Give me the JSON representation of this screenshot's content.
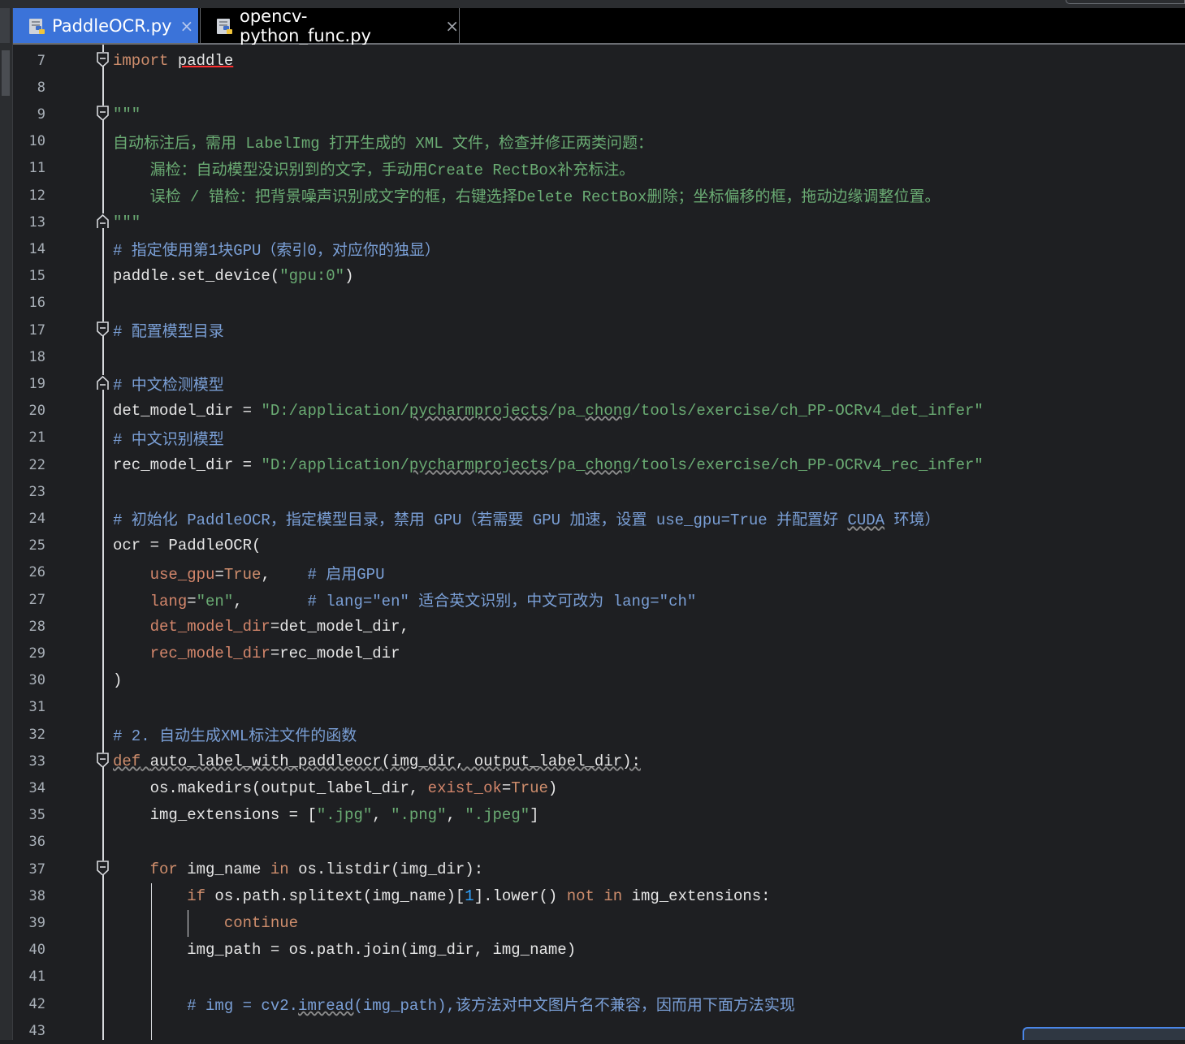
{
  "tabs": [
    {
      "label": "PaddleOCR.py",
      "active": true,
      "icon": "python-file-icon"
    },
    {
      "label": "opencv-python_func.py",
      "active": false,
      "icon": "python-file-icon"
    }
  ],
  "close_glyph": "×",
  "colors": {
    "background": "#1e1f22",
    "active_tab": "#3b73d9",
    "keyword": "#cf8e6d",
    "string": "#6aab73",
    "comment": "#7a9fd6",
    "param": "#d3866b",
    "number": "#2fa3ff",
    "text": "#e6e6e6"
  },
  "lines": [
    {
      "n": "7",
      "t": [
        "import",
        " ",
        "paddle"
      ]
    },
    {
      "n": "8",
      "t": [
        ""
      ]
    },
    {
      "n": "9",
      "t": [
        "\"\"\""
      ]
    },
    {
      "n": "10",
      "t": [
        "自动标注后，需用 LabelImg 打开生成的 XML 文件，检查并修正两类问题："
      ]
    },
    {
      "n": "11",
      "t": [
        "    漏检：自动模型没识别到的文字，手动用Create RectBox补充标注。"
      ]
    },
    {
      "n": "12",
      "t": [
        "    误检 / 错检：把背景噪声识别成文字的框，右键选择Delete RectBox删除；坐标偏移的框，拖动边缘调整位置。"
      ]
    },
    {
      "n": "13",
      "t": [
        "\"\"\""
      ]
    },
    {
      "n": "14",
      "t": [
        "# 指定使用第1块GPU（索引0，对应你的独显）"
      ]
    },
    {
      "n": "15",
      "t": [
        "paddle.set_device(",
        "\"gpu:0\"",
        ")"
      ]
    },
    {
      "n": "16",
      "t": [
        ""
      ]
    },
    {
      "n": "17",
      "t": [
        "# 配置模型目录"
      ]
    },
    {
      "n": "18",
      "t": [
        ""
      ]
    },
    {
      "n": "19",
      "t": [
        "# 中文检测模型"
      ]
    },
    {
      "n": "20",
      "t": [
        "det_model_dir = ",
        "\"D:/application/",
        "pycharmprojects",
        "/pa_",
        "chong",
        "/tools/exercise/ch_PP-OCRv4_det_infer\""
      ]
    },
    {
      "n": "21",
      "t": [
        "# 中文识别模型"
      ]
    },
    {
      "n": "22",
      "t": [
        "rec_model_dir = ",
        "\"D:/application/",
        "pycharmprojects",
        "/pa_",
        "chong",
        "/tools/exercise/ch_PP-OCRv4_rec_infer\""
      ]
    },
    {
      "n": "23",
      "t": [
        ""
      ]
    },
    {
      "n": "24",
      "t": [
        "# 初始化 PaddleOCR，指定模型目录，禁用 GPU（若需要 GPU 加速，设置 use_gpu=True 并配置好 ",
        "CUDA",
        " 环境）"
      ]
    },
    {
      "n": "25",
      "t": [
        "ocr = PaddleOCR("
      ]
    },
    {
      "n": "26",
      "t": [
        "    ",
        "use_gpu",
        "=",
        "True",
        ",    ",
        "# 启用GPU"
      ]
    },
    {
      "n": "27",
      "t": [
        "    ",
        "lang",
        "=",
        "\"en\"",
        ",       ",
        "# lang=\"en\" 适合英文识别，中文可改为 lang=\"ch\""
      ]
    },
    {
      "n": "28",
      "t": [
        "    ",
        "det_model_dir",
        "=det_model_dir,"
      ]
    },
    {
      "n": "29",
      "t": [
        "    ",
        "rec_model_dir",
        "=rec_model_dir"
      ]
    },
    {
      "n": "30",
      "t": [
        ")"
      ]
    },
    {
      "n": "31",
      "t": [
        ""
      ]
    },
    {
      "n": "32",
      "t": [
        "# 2. 自动生成XML标注文件的函数"
      ]
    },
    {
      "n": "33",
      "t": [
        "def",
        " ",
        "auto_label_with_paddleocr",
        "(img_dir, output_label_dir):"
      ]
    },
    {
      "n": "34",
      "t": [
        "    os.makedirs(output_label_dir, ",
        "exist_ok",
        "=",
        "True",
        ")"
      ]
    },
    {
      "n": "35",
      "t": [
        "    img_extensions = [",
        "\".jpg\"",
        ", ",
        "\".png\"",
        ", ",
        "\".jpeg\"",
        "]"
      ]
    },
    {
      "n": "36",
      "t": [
        ""
      ]
    },
    {
      "n": "37",
      "t": [
        "    ",
        "for",
        " img_name ",
        "in",
        " os.listdir(img_dir):"
      ]
    },
    {
      "n": "38",
      "t": [
        "        ",
        "if",
        " os.path.splitext(img_name)[",
        "1",
        "].lower() ",
        "not in",
        " img_extensions:"
      ]
    },
    {
      "n": "39",
      "t": [
        "            ",
        "continue"
      ]
    },
    {
      "n": "40",
      "t": [
        "        img_path = os.path.join(img_dir, img_name)"
      ]
    },
    {
      "n": "41",
      "t": [
        ""
      ]
    },
    {
      "n": "42",
      "t": [
        "        ",
        "# img = cv2.",
        "imread",
        "(img_path),该方法对中文图片名不兼容，因而用下面方法实现"
      ]
    },
    {
      "n": "43",
      "t": [
        ""
      ]
    }
  ]
}
